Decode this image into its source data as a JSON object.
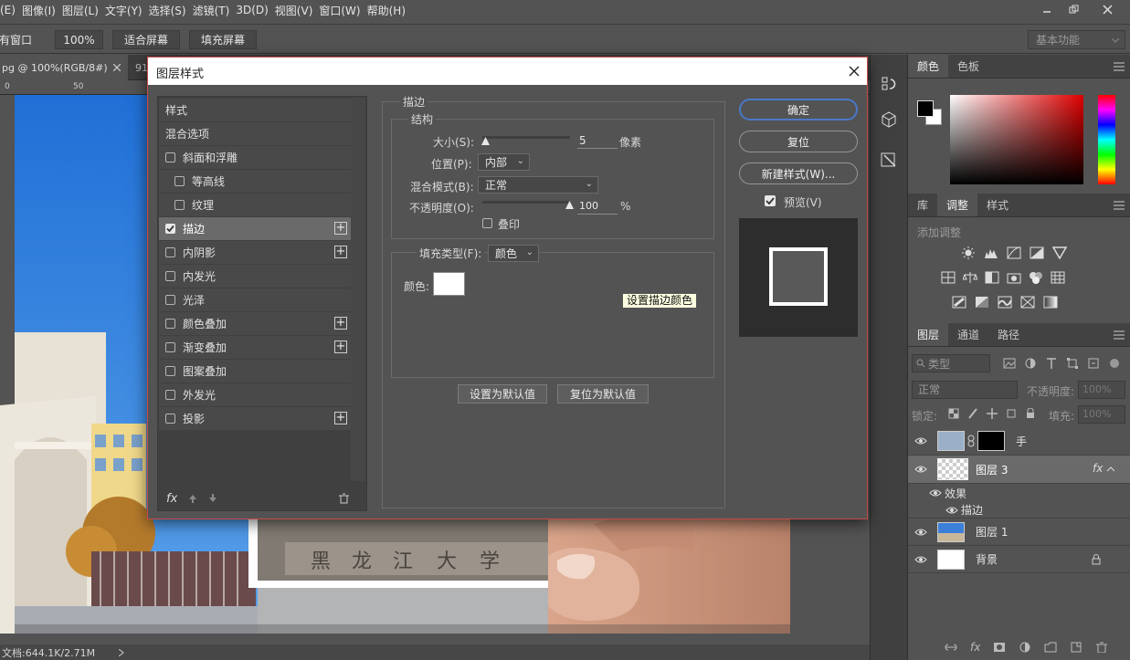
{
  "menubar": {
    "items": [
      "(E)",
      "图像(I)",
      "图层(L)",
      "文字(Y)",
      "选择(S)",
      "滤镜(T)",
      "3D(D)",
      "视图(V)",
      "窗口(W)",
      "帮助(H)"
    ]
  },
  "options_bar": {
    "button1": "有窗口",
    "button2": "100%",
    "button3": "适合屏幕",
    "button4": "填充屏幕",
    "workspace": "基本功能"
  },
  "document": {
    "tab_label": "pg @ 100%(RGB/8#)",
    "tab2_label": "91",
    "ruler_labels": [
      "0",
      "50"
    ],
    "status": "文档:644.1K/2.71M"
  },
  "color_panel": {
    "tabs": [
      "颜色",
      "色板"
    ]
  },
  "adjust_panel": {
    "tabs": [
      "库",
      "调整",
      "样式"
    ],
    "hint": "添加调整"
  },
  "layers_panel": {
    "tabs": [
      "图层",
      "通道",
      "路径"
    ],
    "filter_label": "类型",
    "blend_mode": "正常",
    "opacity_label": "不透明度:",
    "opacity_value": "100%",
    "lock_label": "锁定:",
    "fill_label": "填充:",
    "fill_value": "100%",
    "layers": [
      {
        "name": "手"
      },
      {
        "name": "图层 3"
      },
      {
        "name": "效果"
      },
      {
        "name": "描边"
      },
      {
        "name": "图层 1"
      },
      {
        "name": "背景"
      }
    ]
  },
  "dialog": {
    "title": "图层样式",
    "styles": [
      {
        "label": "样式"
      },
      {
        "label": "混合选项"
      },
      {
        "label": "斜面和浮雕",
        "checked": false
      },
      {
        "label": "等高线",
        "checked": false
      },
      {
        "label": "纹理",
        "checked": false
      },
      {
        "label": "描边",
        "checked": true
      },
      {
        "label": "内阴影",
        "checked": false
      },
      {
        "label": "内发光",
        "checked": false
      },
      {
        "label": "光泽",
        "checked": false
      },
      {
        "label": "颜色叠加",
        "checked": false
      },
      {
        "label": "渐变叠加",
        "checked": false
      },
      {
        "label": "图案叠加",
        "checked": false
      },
      {
        "label": "外发光",
        "checked": false
      },
      {
        "label": "投影",
        "checked": false
      }
    ],
    "stroke": {
      "section_title": "描边",
      "structure_title": "结构",
      "size_label": "大小(S):",
      "size_value": "5",
      "size_unit": "像素",
      "size_fraction": 0.02,
      "position_label": "位置(P):",
      "position_value": "内部",
      "blend_label": "混合模式(B):",
      "blend_value": "正常",
      "opacity_label": "不透明度(O):",
      "opacity_value": "100",
      "opacity_unit": "%",
      "opacity_fraction": 1.0,
      "overprint_label": "叠印",
      "fill_type_label": "填充类型(F):",
      "fill_type_value": "颜色",
      "color_label": "颜色:",
      "stroke_color": "#ffffff",
      "tooltip": "设置描边颜色",
      "set_default": "设置为默认值",
      "reset_default": "复位为默认值"
    },
    "buttons": {
      "ok": "确定",
      "reset": "复位",
      "new_style": "新建样式(W)...",
      "preview": "预览(V)"
    }
  },
  "colors": {
    "ui_bg": "#535353",
    "dialog_border": "#c84a4a",
    "accent": "#4a78c8"
  }
}
